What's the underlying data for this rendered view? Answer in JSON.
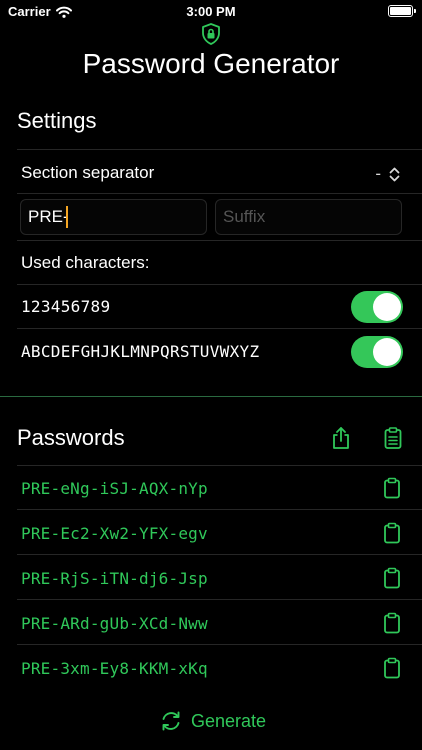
{
  "status_bar": {
    "carrier": "Carrier",
    "time": "3:00 PM"
  },
  "title": "Password Generator",
  "settings": {
    "header": "Settings",
    "separator_label": "Section separator",
    "separator_value": "-",
    "prefix_value": "PRE-",
    "suffix_placeholder": "Suffix",
    "used_characters_label": "Used characters:",
    "charsets": [
      {
        "label": "123456789",
        "enabled": true
      },
      {
        "label": "ABCDEFGHJKLMNPQRSTUVWXYZ",
        "enabled": true
      }
    ]
  },
  "passwords": {
    "header": "Passwords",
    "items": [
      "PRE-eNg-iSJ-AQX-nYp",
      "PRE-Ec2-Xw2-YFX-egv",
      "PRE-RjS-iTN-dj6-Jsp",
      "PRE-ARd-gUb-XCd-Nww",
      "PRE-3xm-Ey8-KKM-xKq"
    ]
  },
  "generate_label": "Generate",
  "colors": {
    "accent": "#30c85a",
    "toggle_on": "#34c759",
    "caret": "#f5a623"
  }
}
